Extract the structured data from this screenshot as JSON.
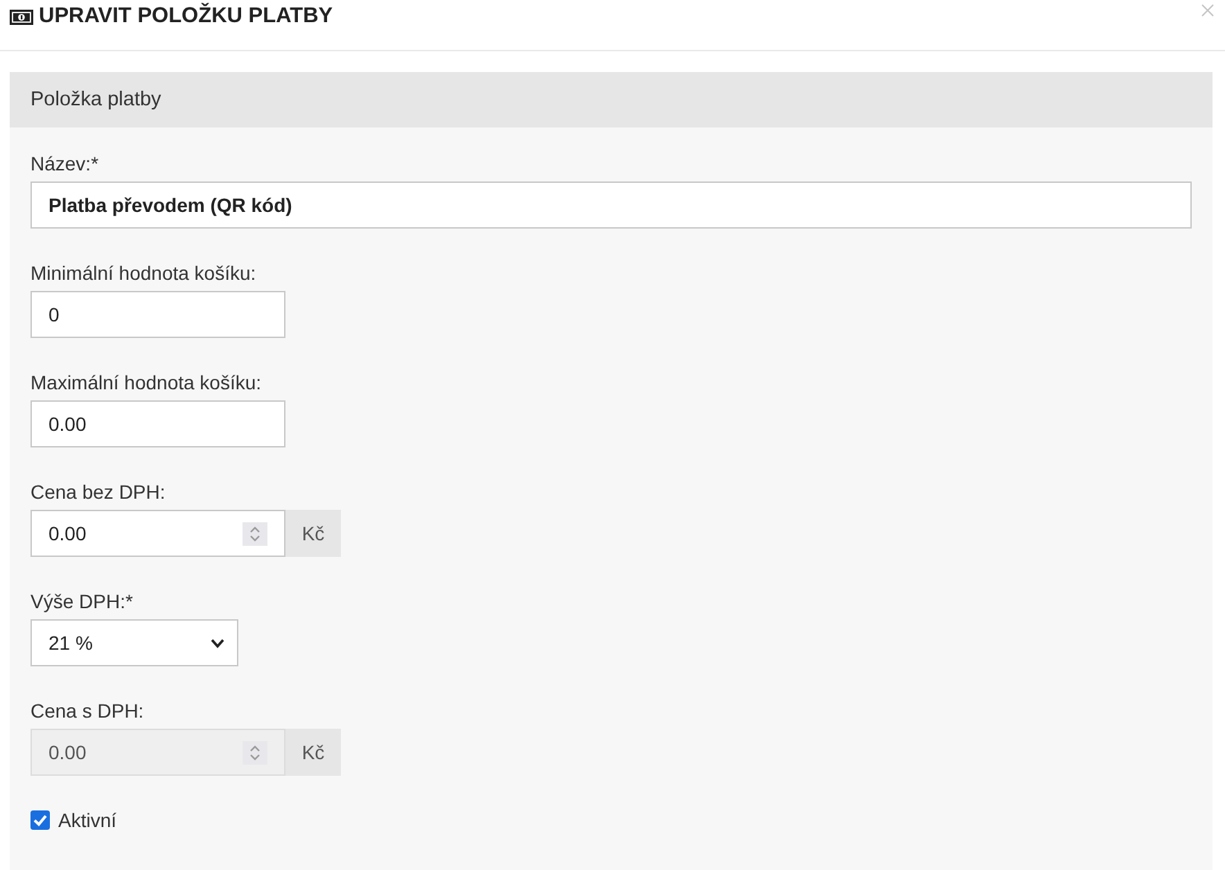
{
  "dialog": {
    "title": "UPRAVIT POLOŽKU PLATBY"
  },
  "panel": {
    "heading": "Položka platby",
    "fields": [
      {
        "kind": "name",
        "label": "Název:*",
        "value": "Platba převodem (QR kód)",
        "disabled": false
      },
      {
        "kind": "text",
        "label": "Minimální hodnota košíku:",
        "value": "0",
        "disabled": false
      },
      {
        "kind": "text",
        "label": "Maximální hodnota košíku:",
        "value": "0.00",
        "disabled": false
      },
      {
        "kind": "price",
        "label": "Cena bez DPH:",
        "value": "0.00",
        "unit": "Kč",
        "disabled": false
      },
      {
        "kind": "select",
        "label": "Výše DPH:*",
        "value": "21 %",
        "disabled": false
      },
      {
        "kind": "price",
        "label": "Cena s DPH:",
        "value": "0.00",
        "unit": "Kč",
        "disabled": true
      },
      {
        "kind": "checkbox",
        "label": "Aktivní",
        "checked": true,
        "disabled": false
      }
    ]
  }
}
